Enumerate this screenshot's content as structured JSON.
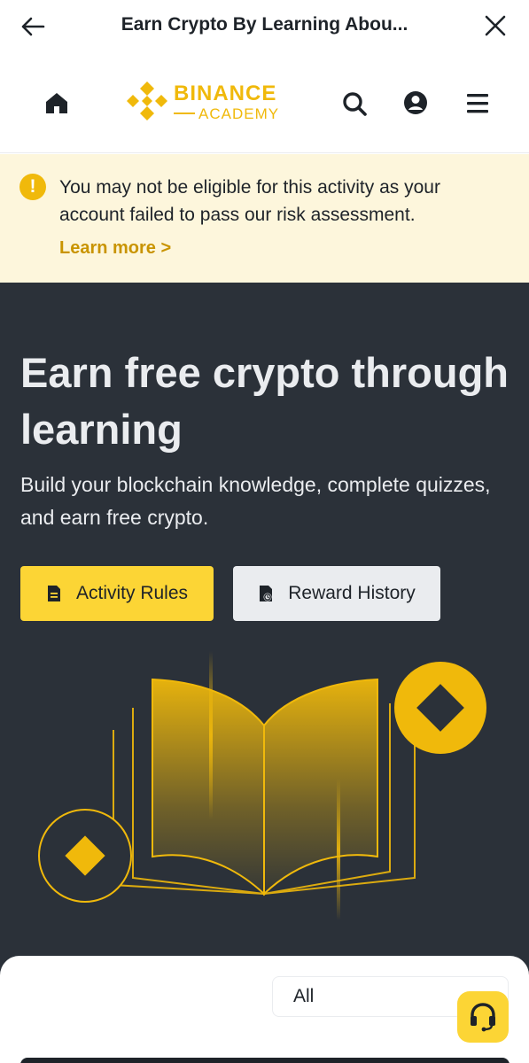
{
  "topbar": {
    "title": "Earn Crypto By Learning Abou...",
    "back_icon": "arrow-left-icon",
    "close_icon": "close-icon"
  },
  "header": {
    "logo_primary": "BINANCE",
    "logo_secondary": "ACADEMY",
    "icons": [
      "home-icon",
      "search-icon",
      "user-icon",
      "menu-icon"
    ]
  },
  "notice": {
    "message": "You may not be eligible for this activity as your account failed to pass our risk assessment.",
    "link": "Learn more >"
  },
  "hero": {
    "title": "Earn free crypto through learning",
    "subtitle": "Build your blockchain knowledge, complete quizzes, and earn free crypto.",
    "activity_rules": "Activity Rules",
    "reward_history": "Reward History"
  },
  "filter": {
    "selected": "All"
  },
  "colors": {
    "brand_yellow": "#F0B90B",
    "button_yellow": "#FCD535",
    "hero_bg": "#2B3139",
    "notice_bg": "#FDF6DC",
    "link_gold": "#C99400"
  }
}
